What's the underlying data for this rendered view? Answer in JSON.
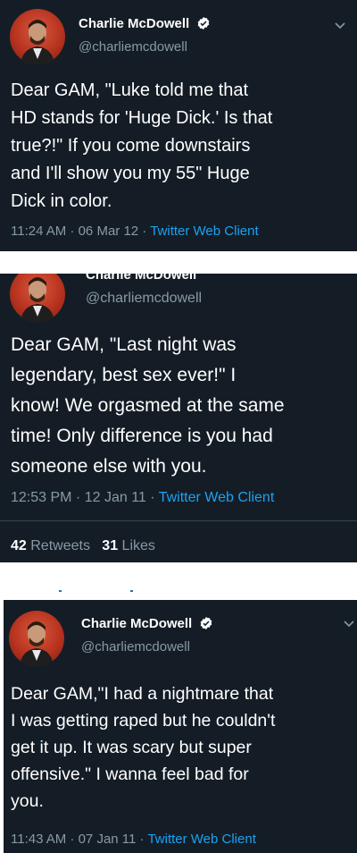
{
  "accent_color": "#1da1f2",
  "background_color": "#141d26",
  "tweets": [
    {
      "name": "Charlie McDowell",
      "handle": "@charliemcdowell",
      "text": "Dear GAM, \"Luke told me that\nHD stands for 'Huge Dick.' Is that\ntrue?!\" If you come downstairs\nand I'll show you my 55\" Huge\nDick in color.",
      "time": "11:24 AM · 06 Mar 12 · ",
      "client": "Twitter Web Client",
      "icons": [
        "avatar",
        "verified-badge-icon",
        "chevron-down-icon"
      ]
    },
    {
      "name": "Charlie McDowell",
      "handle": "@charliemcdowell",
      "text": "Dear GAM, \"Last night was\nlegendary, best sex ever!\" I\nknow! We orgasmed at the same\ntime! Only difference is you had\nsomeone else with you.",
      "time": "12:53 PM · 12 Jan 11 · ",
      "client": "Twitter Web Client",
      "retweets_count": "42",
      "retweets_label": "Retweets",
      "likes_count": "31",
      "likes_label": "Likes"
    },
    {
      "name": "Charlie McDowell",
      "handle": "@charliemcdowell",
      "text": "Dear GAM,\"I had a nightmare that\nI was getting raped but he couldn't\nget it up. It was scary but super\noffensive.\" I wanna feel bad for\nyou.",
      "time": "11:43 AM · 07 Jan 11 · ",
      "client": "Twitter Web Client"
    }
  ]
}
